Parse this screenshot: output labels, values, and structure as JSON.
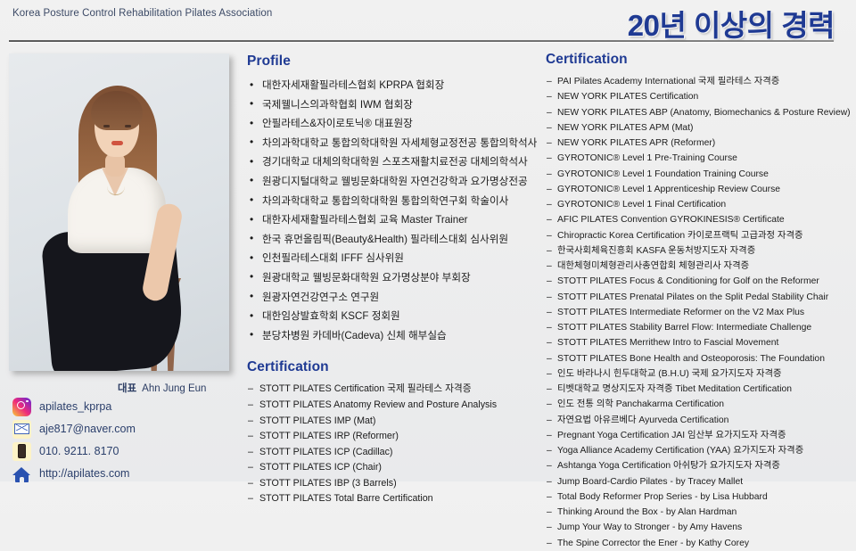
{
  "header": {
    "association": "Korea Posture Control Rehabilitation Pilates Association",
    "headline": "20년 이상의 경력",
    "accent_color": "#1f3a93"
  },
  "photo": {
    "alt_name": "portrait-photo"
  },
  "representative": {
    "label": "대표",
    "name": "Ahn Jung Eun"
  },
  "contact": [
    {
      "icon": "instagram-icon",
      "value": "apilates_kprpa"
    },
    {
      "icon": "email-icon",
      "value": "aje817@naver.com"
    },
    {
      "icon": "phone-icon",
      "value": "010. 9211. 8170"
    },
    {
      "icon": "home-icon",
      "value": "http://apilates.com"
    }
  ],
  "profile": {
    "title": "Profile",
    "items": [
      "대한자세재활필라테스협회 KPRPA 협회장",
      "국제웰니스의과학협회 IWM 협회장",
      "안필라테스&자이로토닉® 대표원장",
      "차의과학대학교 통합의학대학원 자세체형교정전공 통합의학석사",
      "경기대학교 대체의학대학원 스포츠재활치료전공 대체의학석사",
      "원광디지털대학교 웰빙문화대학원 자연건강학과 요가명상전공",
      "차의과학대학교 통합의학대학원 통합의학연구회 학술이사",
      "대한자세재활필라테스협회 교육 Master Trainer",
      "한국 휴먼올림픽(Beauty&Health) 필라테스대회 심사위원",
      "인천필라테스대회 IFFF 심사위원",
      "원광대학교 웰빙문화대학원 요가명상분야 부회장",
      "원광자연건강연구소 연구원",
      "대한임상발효학회 KSCF 정회원",
      "분당차병원 카데바(Cadeva) 신체 해부실습"
    ]
  },
  "certification_mid": {
    "title": "Certification",
    "items": [
      "STOTT PILATES Certification 국제 필라테스 자격증",
      "STOTT PILATES Anatomy Review and Posture Analysis",
      "STOTT PILATES IMP (Mat)",
      "STOTT PILATES IRP (Reformer)",
      "STOTT PILATES ICP (Cadillac)",
      "STOTT PILATES ICP (Chair)",
      "STOTT PILATES IBP (3 Barrels)",
      "STOTT PILATES Total Barre Certification"
    ]
  },
  "certification_right": {
    "title": "Certification",
    "items": [
      "PAI Pilates Academy International 국제 필라테스 자격증",
      "NEW YORK PILATES Certification",
      "NEW YORK PILATES ABP (Anatomy, Biomechanics & Posture Review)",
      "NEW YORK PILATES APM (Mat)",
      "NEW YORK PILATES APR (Reformer)",
      "GYROTONIC® Level 1 Pre-Training Course",
      "GYROTONIC® Level 1 Foundation Training Course",
      "GYROTONIC® Level 1 Apprenticeship Review Course",
      "GYROTONIC® Level 1 Final Certification",
      "AFIC PILATES Convention GYROKINESIS® Certificate",
      "Chiropractic Korea Certification 카이로프랙틱 고급과정 자격증",
      "한국사회체육진흥회 KASFA 운동처방지도자 자격증",
      "대한체형미체형관리사총연합회 체형관리사 자격증",
      "STOTT PILATES Focus & Conditioning for Golf on the Reformer",
      "STOTT PILATES Prenatal Pilates on the Split Pedal Stability Chair",
      "STOTT PILATES Intermediate Reformer on the V2 Max Plus",
      "STOTT PILATES Stability Barrel Flow: Intermediate Challenge",
      "STOTT PILATES Merrithew Intro to Fascial Movement",
      "STOTT PILATES Bone Health and Osteoporosis: The Foundation",
      "인도 바라나시 힌두대학교 (B.H.U) 국제 요가지도자 자격증",
      "티벳대학교 명상지도자 자격증 Tibet Meditation Certification",
      "인도 전통 의학 Panchakarma Certification",
      "자연요법 아유르베다 Ayurveda Certification",
      "Pregnant Yoga Certification JAI 임산부 요가지도자 자격증",
      "Yoga Alliance Academy Certification (YAA) 요가지도자 자격증",
      "Ashtanga Yoga Certification 아쉬탕가 요가지도자 자격증",
      "Jump Board-Cardio Pilates - by Tracey Mallet",
      "Total Body Reformer Prop Series - by Lisa Hubbard",
      "Thinking Around the Box - by Alan Hardman",
      "Jump Your Way to Stronger - by Amy Havens",
      "The Spine Corrector the Ener - by Kathy Corey"
    ]
  }
}
